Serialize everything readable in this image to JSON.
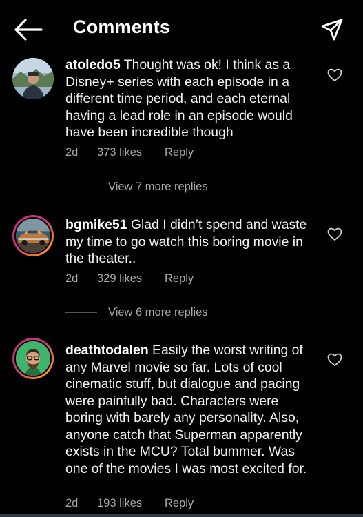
{
  "header": {
    "title": "Comments",
    "back_icon": "arrow-left-icon",
    "share_icon": "paper-plane-icon"
  },
  "comments": [
    {
      "username": "atoledo5",
      "text": " Thought was ok! I think as a Disney+ series with each episode in a different time period, and each eternal having a lead role in an episode would have been incredible though",
      "time": "2d",
      "likes": "373 likes",
      "reply": "Reply",
      "view_replies": "View 7 more replies"
    },
    {
      "username": "bgmike51",
      "text": " Glad I didn’t spend and waste my time to go watch this boring movie in the theater..",
      "time": "2d",
      "likes": "329 likes",
      "reply": "Reply",
      "view_replies": "View 6 more replies"
    },
    {
      "username": "deathtodalen",
      "text": " Easily the worst writing of any Marvel movie so far. Lots of cool cinematic stuff, but dialogue and pacing were painfully bad. Characters were boring with barely any personality. Also, anyone catch that Superman apparently exists in the MCU? Total bummer. Was one of the movies I was most excited for.",
      "time": "2d",
      "likes": "193 likes",
      "reply": "Reply"
    }
  ],
  "colors": {
    "background": "#000000",
    "text": "#f2f2f2",
    "secondary_text": "#a8a8a8",
    "story_ring_start": "#d62976",
    "story_ring_end": "#feda75"
  }
}
